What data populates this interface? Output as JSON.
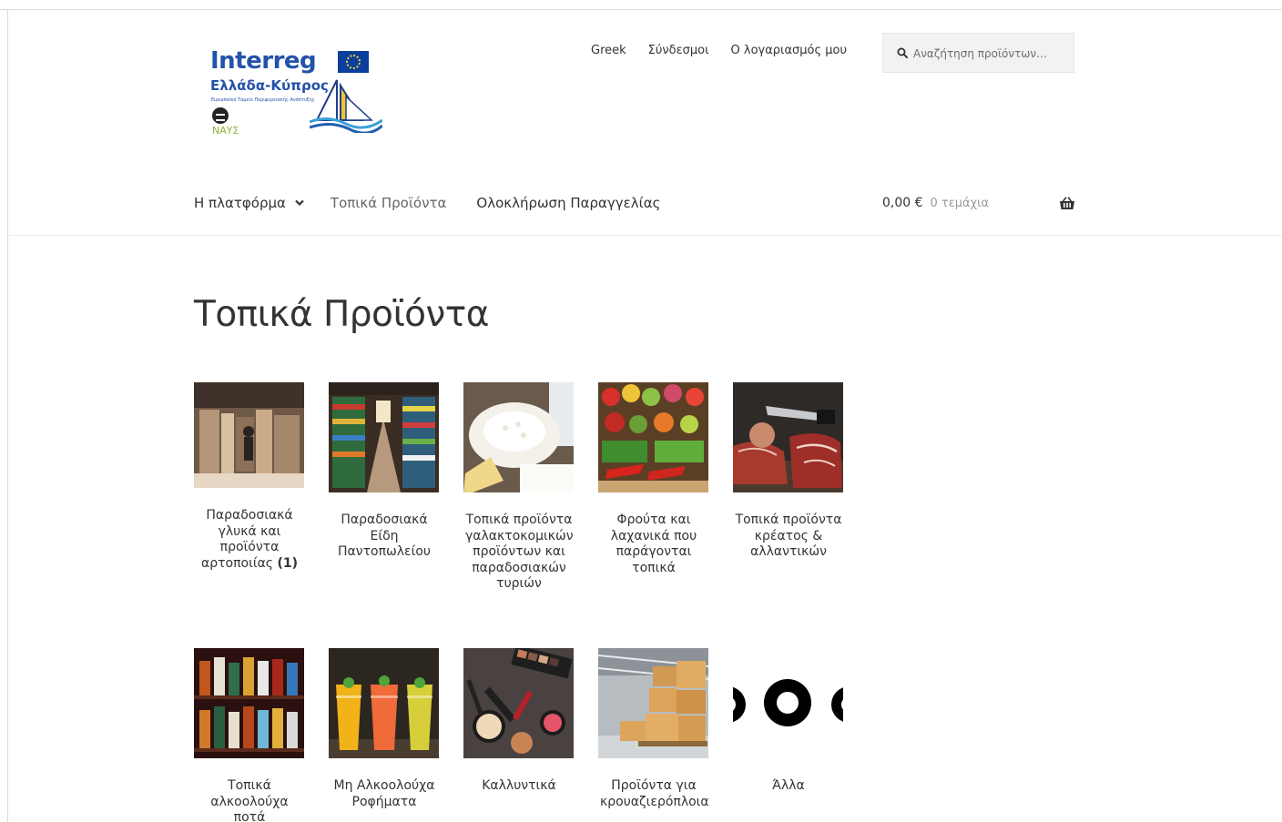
{
  "logo": {
    "title": "Interreg",
    "subtitle": "Ελλάδα-Κύπρος",
    "tagline": "Ευρωπαϊκό Ταμείο Περιφερειακής Ανάπτυξης",
    "project": "ΝΑΥΣ"
  },
  "secondary_nav": {
    "items": [
      {
        "label": "Greek"
      },
      {
        "label": "Σύνδεσμοι"
      },
      {
        "label": "Ο λογαριασμός μου"
      }
    ]
  },
  "search": {
    "placeholder": "Αναζήτηση προϊόντων…"
  },
  "primary_nav": {
    "items": [
      {
        "label": "Η πλατφόρμα"
      },
      {
        "label": "Τοπικά Προϊόντα"
      },
      {
        "label": "Ολοκλήρωση Παραγγελίας"
      }
    ]
  },
  "cart": {
    "amount": "0,00 €",
    "count": "0 τεμάχια"
  },
  "page": {
    "title": "Τοπικά Προϊόντα"
  },
  "categories": [
    {
      "name": "Παραδοσιακά γλυκά και προϊόντα αρτοποιίας",
      "count": "(1)"
    },
    {
      "name": "Παραδοσιακά Είδη Παντοπωλείου",
      "count": ""
    },
    {
      "name": "Τοπικά προϊόντα γαλακτοκομικών προϊόντων και παραδοσιακών τυριών",
      "count": ""
    },
    {
      "name": "Φρούτα και λαχανικά που παράγονται τοπικά",
      "count": ""
    },
    {
      "name": "Τοπικά προϊόντα κρέατος & αλλαντικών",
      "count": ""
    },
    {
      "name": "Τοπικά αλκοολούχα ποτά",
      "count": ""
    },
    {
      "name": "Μη Αλκοολούχα Ροφήματα",
      "count": ""
    },
    {
      "name": "Καλλυντικά",
      "count": ""
    },
    {
      "name": "Προϊόντα για κρουαζιερόπλοια",
      "count": ""
    },
    {
      "name": "Άλλα",
      "count": ""
    }
  ]
}
